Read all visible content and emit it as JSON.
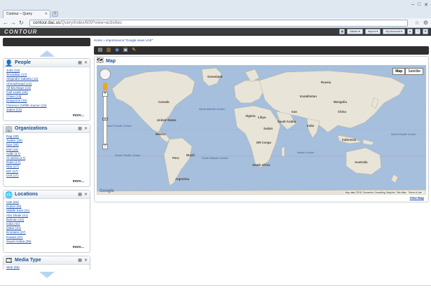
{
  "browser": {
    "tab_title": "Contour – Query",
    "url_host": "contour.dac.us",
    "url_path": "/Query/Index/609?view=activities"
  },
  "app": {
    "logo": "CONTOUR",
    "header_buttons": [
      "Admin ▾",
      "Import ▾",
      "My Account ▾"
    ]
  },
  "breadcrumb": {
    "home": "Home",
    "sep": "»",
    "current": "importsource:\"Google news UAE\""
  },
  "panels": [
    {
      "title": "People",
      "icon": "person-icon",
      "items": [
        "Jobs (18)",
        "Tendulkar (17)",
        "Alejandro Sabella (12)",
        "Ahmadinejad (14)",
        "Alf Ma Maye (13)",
        "Carl Lewis (15)",
        "Chiao (13)",
        "Dragoons (15)",
        "Florence Griffith-Joyner (13)",
        "Jaipra (13)"
      ],
      "more": "more..."
    },
    {
      "title": "Organizations",
      "icon": "building-icon",
      "items": [
        "Rag (30)",
        "Twitter (28)",
        "Dps (26)",
        "DW (16)",
        "Adds (17)",
        "Al Jazira (17)",
        "Dubs (17)",
        "Nba (17)",
        "NFI (17)",
        "Unit (17)"
      ],
      "more": "more..."
    },
    {
      "title": "Locations",
      "icon": "globe-icon",
      "items": [
        "Uae (63)",
        "Dubai (46)",
        "Middle East (31)",
        "Abu Dhabi (41)",
        "Bahrain (41)",
        "India (41)",
        "Qatar (41)",
        "Emirates (37)",
        "Kuwait (37)",
        "Saudi Arabia (26)"
      ],
      "more": "more..."
    },
    {
      "title": "Media Type",
      "icon": "media-icon",
      "items": [
        "Web (96)"
      ],
      "more": ""
    }
  ],
  "map": {
    "title": "Map",
    "type_buttons": [
      "Map",
      "Satellite"
    ],
    "data_credit": "Map data ©2011 Geocentre Consulting, MapLink, Tele Atlas · Terms of Use",
    "google_logo": "Google",
    "view_link": "View Map",
    "labels": {
      "canada": "Canada",
      "united_states": "United States",
      "mexico": "Mexico",
      "brazil": "Brazil",
      "russia": "Russia",
      "china": "China",
      "india": "India",
      "australia": "Australia",
      "kazakhstan": "Kazakhstan",
      "sudan": "Sudan",
      "algeria": "Algeria",
      "greenland": "Greenland",
      "north_pacific": "North Pacific Ocean",
      "south_pacific": "South Pacific Ocean",
      "south_atlantic": "South Atlantic Ocean",
      "north_atlantic": "North Atlantic Ocean",
      "indian_ocean": "Indian Ocean",
      "argentina": "Argentina",
      "peru": "Peru",
      "libya": "Libya",
      "iran": "Iran",
      "saudi_arabia": "Saudi Arabia",
      "mongolia": "Mongolia",
      "indonesia": "Indonesia",
      "south_africa": "South Africa",
      "dr_congo": "DR Congo"
    }
  },
  "colors": {
    "link": "#1e4fa8",
    "panel_title": "#1f4e8c",
    "ocean": "#a5bfdd",
    "land": "#e8e4d8"
  }
}
